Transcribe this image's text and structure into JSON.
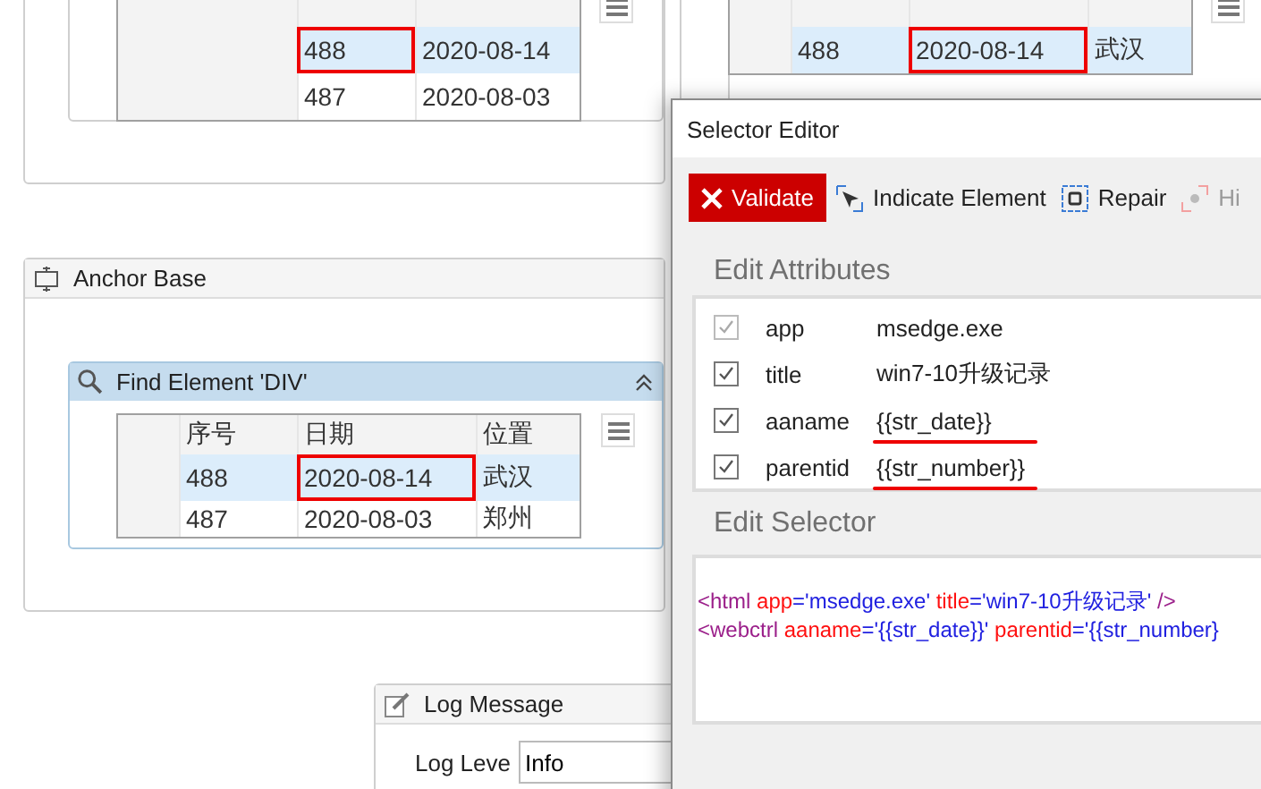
{
  "top_left_table": {
    "rows": [
      {
        "selected": true,
        "cells": [
          {
            "text": "488",
            "marked": true
          },
          {
            "text": "2020-08-14",
            "marked": false
          }
        ]
      },
      {
        "selected": false,
        "cells": [
          {
            "text": "487",
            "marked": false
          },
          {
            "text": "2020-08-03",
            "marked": false
          }
        ]
      }
    ]
  },
  "top_right_table": {
    "rows": [
      {
        "selected": true,
        "cells": [
          {
            "text": "488",
            "marked": false
          },
          {
            "text": "2020-08-14",
            "marked": true
          },
          {
            "text": "武汉",
            "marked": false
          }
        ]
      }
    ]
  },
  "anchor_base": {
    "title": "Anchor Base",
    "find_element": {
      "title": "Find Element 'DIV'",
      "columns": [
        "序号",
        "日期",
        "位置"
      ],
      "rows": [
        {
          "selected": true,
          "cells": [
            {
              "text": "488",
              "marked": false
            },
            {
              "text": "2020-08-14",
              "marked": true
            },
            {
              "text": "武汉",
              "marked": false
            }
          ]
        },
        {
          "selected": false,
          "cells": [
            {
              "text": "487",
              "marked": false
            },
            {
              "text": "2020-08-03",
              "marked": false
            },
            {
              "text": "郑州",
              "marked": false
            }
          ]
        }
      ]
    }
  },
  "log_message": {
    "title": "Log Message",
    "label": "Log Leve",
    "value": "Info"
  },
  "dialog": {
    "title": "Selector Editor",
    "toolbar": [
      {
        "kind": "validate",
        "label": "Validate",
        "disabled": false
      },
      {
        "kind": "indicate",
        "label": "Indicate Element",
        "disabled": false
      },
      {
        "kind": "repair",
        "label": "Repair",
        "disabled": false
      },
      {
        "kind": "highlight",
        "label": "Hi",
        "disabled": true
      }
    ],
    "attributes_heading": "Edit Attributes",
    "attributes": [
      {
        "name": "app",
        "value": "msedge.exe",
        "checked": true,
        "disabled": true,
        "underlined": false
      },
      {
        "name": "title",
        "value": "win7-10升级记录",
        "checked": true,
        "disabled": false,
        "underlined": false
      },
      {
        "name": "aaname",
        "value": "{{str_date}}",
        "checked": true,
        "disabled": false,
        "underlined": true
      },
      {
        "name": "parentid",
        "value": "{{str_number}}",
        "checked": true,
        "disabled": false,
        "underlined": true
      }
    ],
    "selector_heading": "Edit Selector",
    "selector_lines": [
      [
        {
          "kind": "tag",
          "text": "<html"
        },
        {
          "kind": "attr",
          "text": " app"
        },
        {
          "kind": "value",
          "text": "='msedge.exe'"
        },
        {
          "kind": "attr",
          "text": " title"
        },
        {
          "kind": "value",
          "text": "='win7-10升级记录'"
        },
        {
          "kind": "tag",
          "text": " />"
        }
      ],
      [
        {
          "kind": "tag",
          "text": "<webctrl"
        },
        {
          "kind": "attr",
          "text": " aaname"
        },
        {
          "kind": "value",
          "text": "='{{str_date}}'"
        },
        {
          "kind": "attr",
          "text": " parentid"
        },
        {
          "kind": "value",
          "text": "='{{str_number}"
        }
      ]
    ]
  }
}
